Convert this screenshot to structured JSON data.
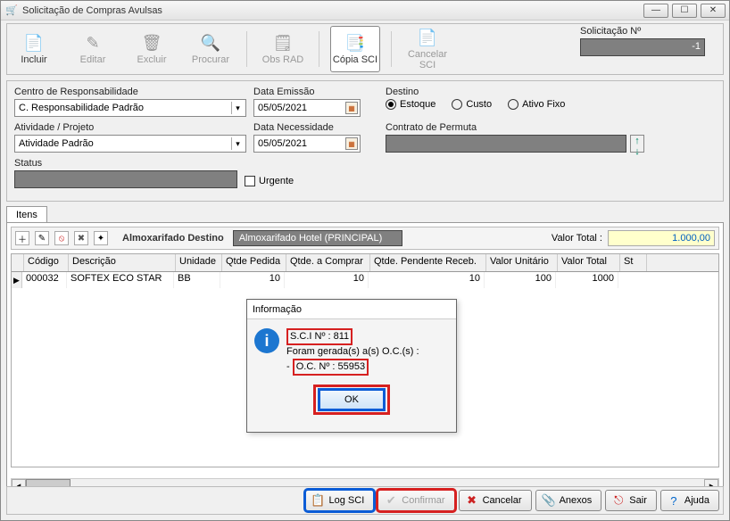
{
  "window": {
    "title": "Solicitação de Compras Avulsas"
  },
  "toolbar": {
    "incluir": "Incluir",
    "editar": "Editar",
    "excluir": "Excluir",
    "procurar": "Procurar",
    "obs_rad": "Obs RAD",
    "copia_sci": "Cópia SCI",
    "cancelar_sci": "Cancelar SCI",
    "solic_label": "Solicitação Nº",
    "solic_value": "-1"
  },
  "form": {
    "centro_label": "Centro de Responsabilidade",
    "centro_value": "C. Responsabilidade Padrão",
    "atividade_label": "Atividade / Projeto",
    "atividade_value": "Atividade Padrão",
    "status_label": "Status",
    "urgente_label": "Urgente",
    "data_emissao_label": "Data Emissão",
    "data_emissao_value": "05/05/2021",
    "data_necessidade_label": "Data Necessidade",
    "data_necessidade_value": "05/05/2021",
    "destino_label": "Destino",
    "destino_options": {
      "estoque": "Estoque",
      "custo": "Custo",
      "ativo": "Ativo Fixo"
    },
    "contrato_label": "Contrato de Permuta"
  },
  "tabs": {
    "itens": "Itens"
  },
  "sub": {
    "almox_label": "Almoxarifado Destino",
    "almox_value": "Almoxarifado Hotel (PRINCIPAL)",
    "valtot_label": "Valor Total :",
    "valtot_value": "1.000,00"
  },
  "grid": {
    "headers": [
      "Código",
      "Descrição",
      "Unidade",
      "Qtde Pedida",
      "Qtde. a Comprar",
      "Qtde. Pendente Receb.",
      "Valor Unitário",
      "Valor Total",
      "St"
    ],
    "row": {
      "codigo": "000032",
      "descricao": "SOFTEX  ECO STAR",
      "unidade": "BB",
      "qtde_pedida": "10",
      "qtde_comprar": "10",
      "qtde_pend": "10",
      "valor_unit": "100",
      "valor_total": "1000"
    }
  },
  "dialog": {
    "title": "Informação",
    "line1": "S.C.I Nº : 811",
    "line2": "Foram gerada(s) a(s) O.C.(s) :",
    "line3_prefix": "- ",
    "line3_box": "O.C. Nº : 55953",
    "ok": "OK"
  },
  "footer": {
    "log_sci": "Log SCI",
    "confirmar": "Confirmar",
    "cancelar": "Cancelar",
    "anexos": "Anexos",
    "sair": "Sair",
    "ajuda": "Ajuda"
  }
}
